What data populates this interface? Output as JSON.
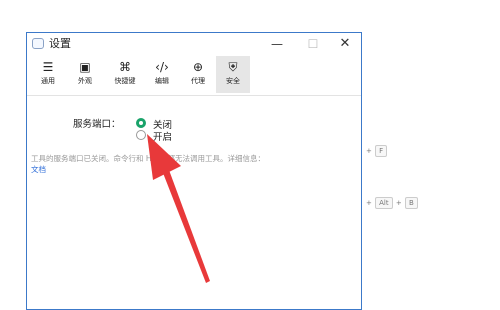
{
  "window": {
    "title": "设置",
    "controls": {
      "minimize": "—",
      "maximize": "☐",
      "close": "✕"
    }
  },
  "toolbar": {
    "tabs": [
      {
        "label": "通用",
        "icon": "sliders-icon",
        "glyph": "☰"
      },
      {
        "label": "外观",
        "icon": "window-icon",
        "glyph": "▣"
      },
      {
        "label": "快捷键",
        "icon": "command-key-icon",
        "glyph": "⌘"
      },
      {
        "label": "编辑",
        "icon": "code-brackets-icon",
        "glyph": "‹/›"
      },
      {
        "label": "代理",
        "icon": "globe-icon",
        "glyph": "⊕"
      },
      {
        "label": "安全",
        "icon": "shield-icon",
        "glyph": "⛨"
      }
    ],
    "active_tab": "安全"
  },
  "security": {
    "port_label": "服务端口：",
    "options": [
      {
        "label": "关闭",
        "selected": true
      },
      {
        "label": "开启",
        "selected": false
      }
    ],
    "info_text": "工具的服务端口已关闭。命令行和 HTTP 都无法调用工具。详细信息：",
    "info_link": "文档"
  },
  "background_shortcuts": {
    "row1": {
      "plus": "+",
      "key": "F"
    },
    "row2": {
      "plus1": "+",
      "key1": "Alt",
      "plus2": "+",
      "key2": "B"
    }
  },
  "colors": {
    "accent_green": "#1aa36a",
    "link_blue": "#2f6ed8",
    "arrow_red": "#e8393a",
    "window_border": "#3c79c9"
  }
}
